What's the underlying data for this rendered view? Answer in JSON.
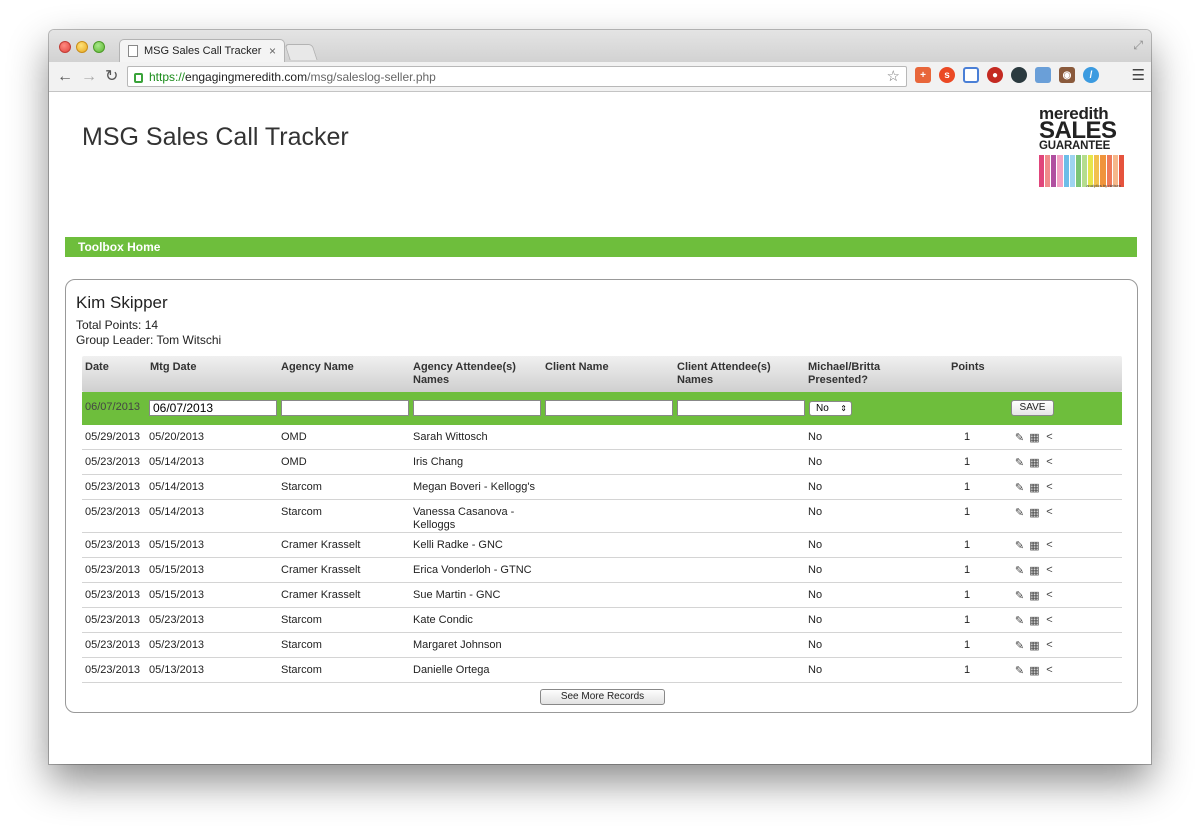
{
  "browser": {
    "tab_title": "MSG Sales Call Tracker",
    "tab_close": "×",
    "url_scheme": "https://",
    "url_host": "engagingmeredith.com",
    "url_path": "/msg/saleslog-seller.php"
  },
  "page": {
    "title": "MSG Sales Call Tracker",
    "logo": {
      "line1": "meredith",
      "line2": "SALES",
      "line3": "GUARANTEE",
      "tagline": "analytics by nielsen"
    }
  },
  "nav": {
    "toolbox_home": "Toolbox Home"
  },
  "seller": {
    "name": "Kim Skipper",
    "total_points": "Total Points: 14",
    "group_leader": "Group Leader: Tom Witschi"
  },
  "table": {
    "headers": {
      "date": "Date",
      "mtg_date": "Mtg Date",
      "agency_name": "Agency Name",
      "agency_attendees": "Agency Attendee(s) Names",
      "client_name": "Client Name",
      "client_attendees": "Client Attendee(s) Names",
      "presented": "Michael/Britta Presented?",
      "points": "Points"
    },
    "entry": {
      "date": "06/07/2013",
      "mtg_date_value": "06/07/2013",
      "presented_value": "No",
      "save_label": "SAVE"
    },
    "rows": [
      {
        "date": "05/29/2013",
        "mtg_date": "05/20/2013",
        "agency": "OMD",
        "agency_attendees": "Sarah Wittosch",
        "client": "",
        "client_attendees": "",
        "presented": "No",
        "points": "1"
      },
      {
        "date": "05/23/2013",
        "mtg_date": "05/14/2013",
        "agency": "OMD",
        "agency_attendees": "Iris Chang",
        "client": "",
        "client_attendees": "",
        "presented": "No",
        "points": "1"
      },
      {
        "date": "05/23/2013",
        "mtg_date": "05/14/2013",
        "agency": "Starcom",
        "agency_attendees": "Megan Boveri - Kellogg's",
        "client": "",
        "client_attendees": "",
        "presented": "No",
        "points": "1"
      },
      {
        "date": "05/23/2013",
        "mtg_date": "05/14/2013",
        "agency": "Starcom",
        "agency_attendees": "Vanessa Casanova - Kelloggs",
        "client": "",
        "client_attendees": "",
        "presented": "No",
        "points": "1"
      },
      {
        "date": "05/23/2013",
        "mtg_date": "05/15/2013",
        "agency": "Cramer Krasselt",
        "agency_attendees": "Kelli Radke - GNC",
        "client": "",
        "client_attendees": "",
        "presented": "No",
        "points": "1"
      },
      {
        "date": "05/23/2013",
        "mtg_date": "05/15/2013",
        "agency": "Cramer Krasselt",
        "agency_attendees": "Erica Vonderloh - GTNC",
        "client": "",
        "client_attendees": "",
        "presented": "No",
        "points": "1"
      },
      {
        "date": "05/23/2013",
        "mtg_date": "05/15/2013",
        "agency": "Cramer Krasselt",
        "agency_attendees": "Sue Martin - GNC",
        "client": "",
        "client_attendees": "",
        "presented": "No",
        "points": "1"
      },
      {
        "date": "05/23/2013",
        "mtg_date": "05/23/2013",
        "agency": "Starcom",
        "agency_attendees": "Kate Condic",
        "client": "",
        "client_attendees": "",
        "presented": "No",
        "points": "1"
      },
      {
        "date": "05/23/2013",
        "mtg_date": "05/23/2013",
        "agency": "Starcom",
        "agency_attendees": "Margaret Johnson",
        "client": "",
        "client_attendees": "",
        "presented": "No",
        "points": "1"
      },
      {
        "date": "05/23/2013",
        "mtg_date": "05/13/2013",
        "agency": "Starcom",
        "agency_attendees": "Danielle Ortega",
        "client": "",
        "client_attendees": "",
        "presented": "No",
        "points": "1"
      }
    ],
    "row_actions": [
      "edit-icon",
      "calendar-icon",
      "share-icon"
    ],
    "see_more": "See More Records"
  },
  "colors": {
    "accent_green": "#6ebe3c"
  }
}
